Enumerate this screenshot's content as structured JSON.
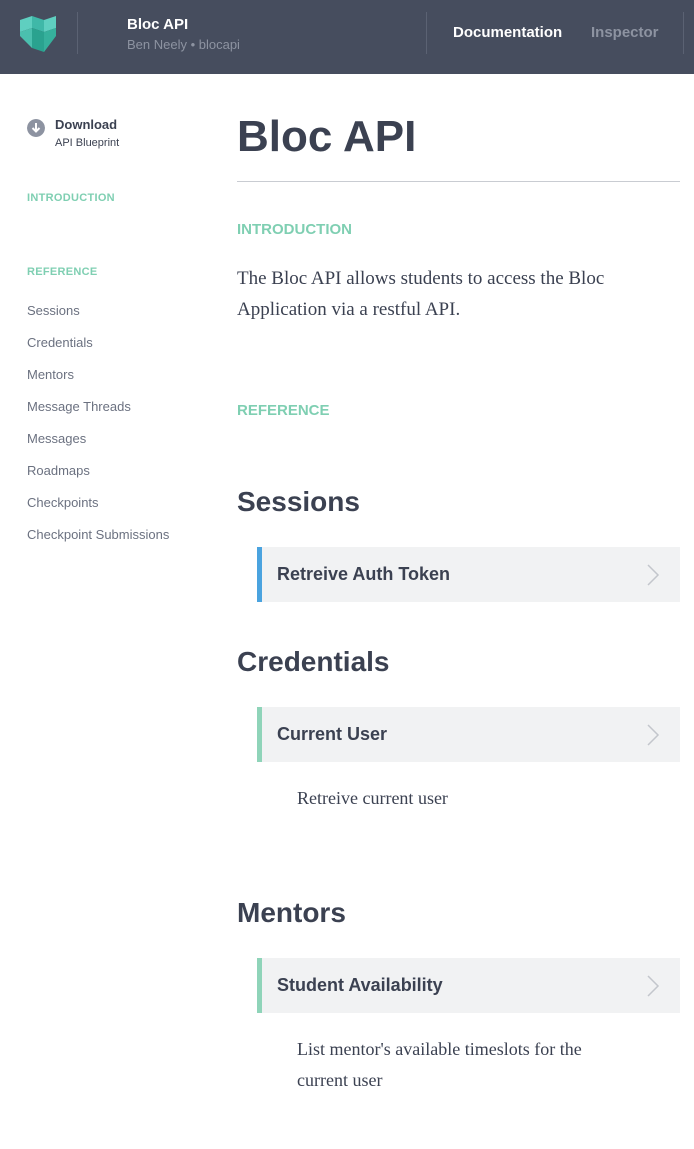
{
  "header": {
    "api_name": "Bloc API",
    "owner": "Ben Neely • blocapi",
    "nav_documentation": "Documentation",
    "nav_inspector": "Inspector"
  },
  "sidebar": {
    "download_title": "Download",
    "download_subtitle": "API Blueprint",
    "intro_label": "INTRODUCTION",
    "reference_label": "REFERENCE",
    "links": [
      "Sessions",
      "Credentials",
      "Mentors",
      "Message Threads",
      "Messages",
      "Roadmaps",
      "Checkpoints",
      "Checkpoint Submissions"
    ]
  },
  "main": {
    "title": "Bloc API",
    "intro_label": "INTRODUCTION",
    "intro_text": "The Bloc API allows students to access the Bloc Application via a restful API.",
    "reference_label": "REFERENCE",
    "sections": [
      {
        "title": "Sessions",
        "action": "Retreive Auth Token",
        "description": ""
      },
      {
        "title": "Credentials",
        "action": "Current User",
        "description": "Retreive current user"
      },
      {
        "title": "Mentors",
        "action": "Student Availability",
        "description": "List mentor's available timeslots for the current user"
      }
    ]
  },
  "colors": {
    "header_bg": "#464d5e",
    "accent_green": "#7fcfb2",
    "action_blue": "#4aa3df",
    "action_green": "#8fd4b9"
  }
}
